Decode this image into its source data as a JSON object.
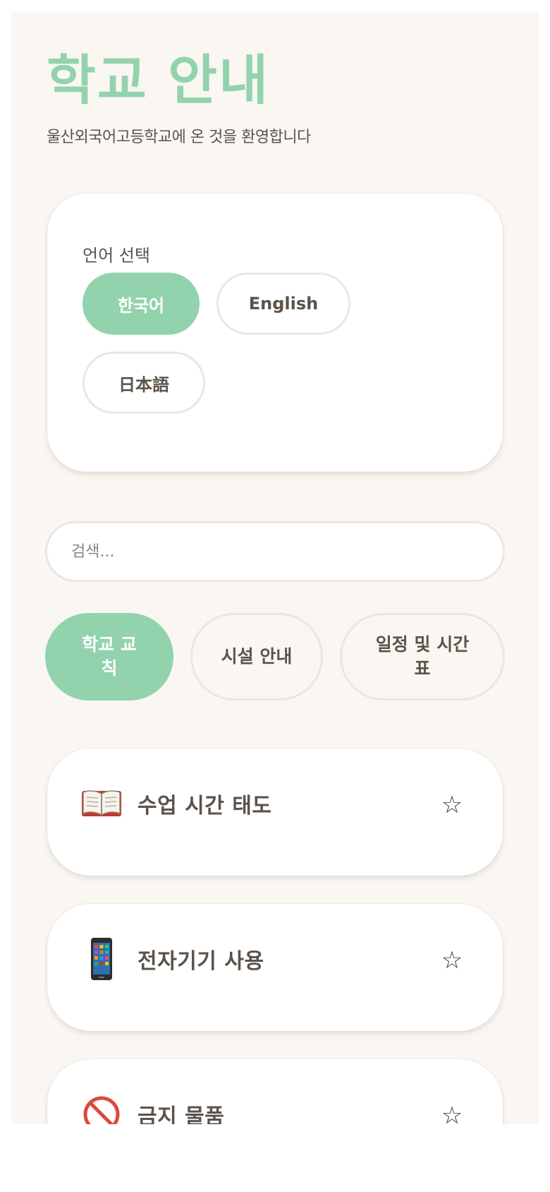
{
  "header": {
    "title": "학교 안내",
    "subtitle": "울산외국어고등학교에 온 것을 환영합니다"
  },
  "language": {
    "label": "언어 선택",
    "options": [
      {
        "label": "한국어",
        "active": true
      },
      {
        "label": "English",
        "active": false
      },
      {
        "label": "日本語",
        "active": false
      }
    ]
  },
  "search": {
    "placeholder": "검색...",
    "value": ""
  },
  "tabs": [
    {
      "label": "학교 교칙",
      "active": true
    },
    {
      "label": "시설 안내",
      "active": false
    },
    {
      "label": "일정 및 시간표",
      "active": false
    }
  ],
  "cards": [
    {
      "icon": "book-icon",
      "title": "수업 시간 태도",
      "favorite": false
    },
    {
      "icon": "phone-icon",
      "title": "전자기기 사용",
      "favorite": false
    },
    {
      "icon": "prohibited-icon",
      "title": "금지 물품",
      "favorite": false
    }
  ],
  "icons": {
    "star": "☆"
  },
  "colors": {
    "accent": "#92d3ae",
    "background": "#faf6f2",
    "text": "#5c5249",
    "border": "#ece6e1"
  }
}
